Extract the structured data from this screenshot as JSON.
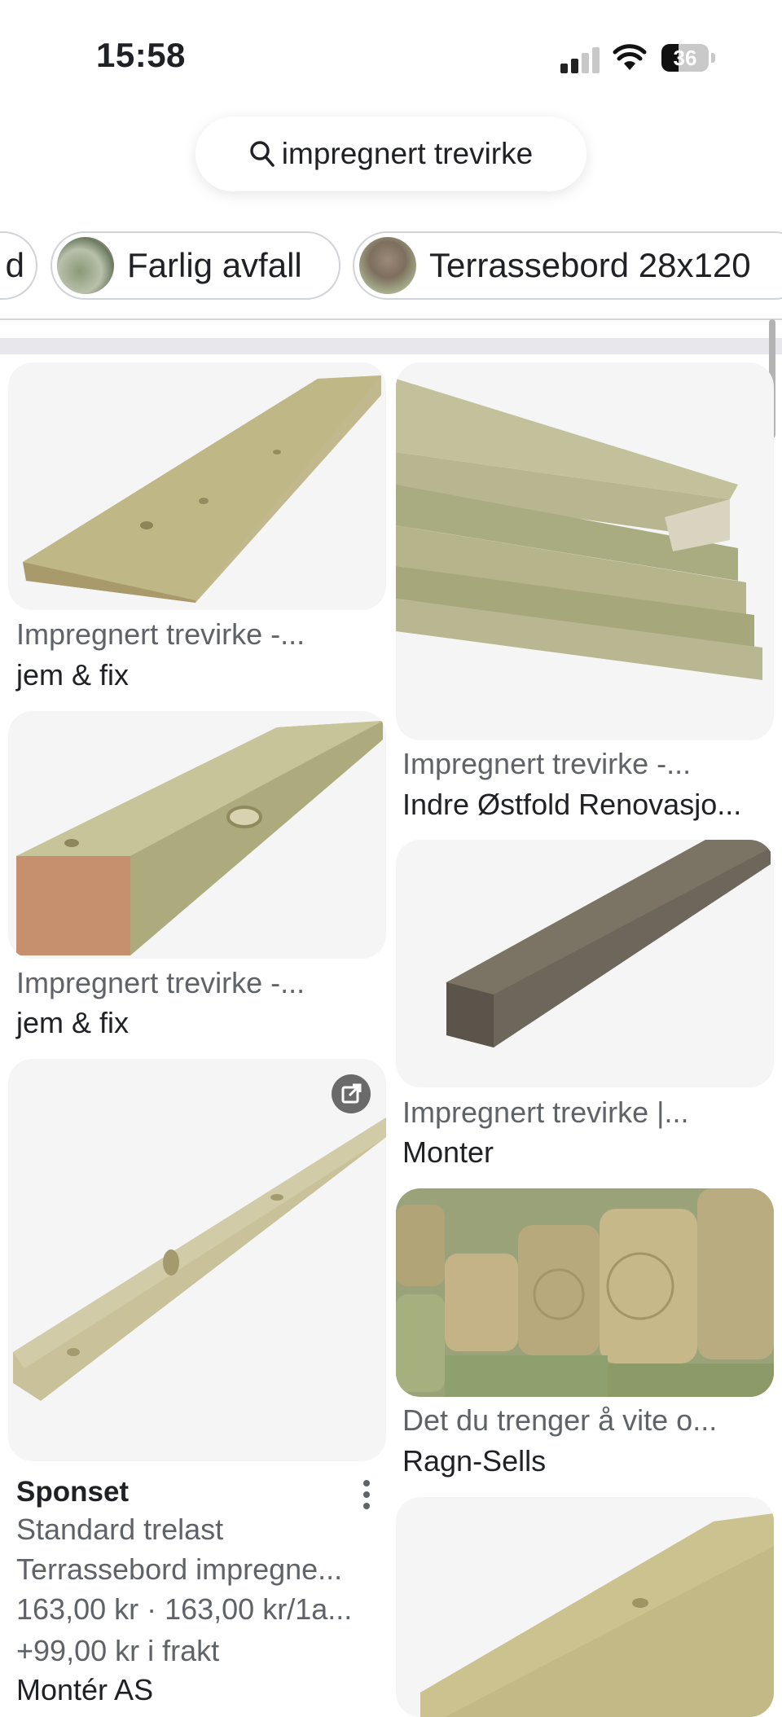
{
  "status_bar": {
    "time": "15:58",
    "battery": "36"
  },
  "search": {
    "query": "impregnert trevirke"
  },
  "chips": [
    {
      "label": "d"
    },
    {
      "label": "Farlig avfall"
    },
    {
      "label": "Terrassebord 28x120"
    }
  ],
  "results": {
    "left": [
      {
        "title": "Impregnert trevirke -...",
        "source": "jem & fix"
      },
      {
        "title": "Impregnert trevirke -...",
        "source": "jem & fix"
      }
    ],
    "right": [
      {
        "title": "Impregnert trevirke -...",
        "source": "Indre Østfold Renovasjo..."
      },
      {
        "title": "Impregnert trevirke |...",
        "source": "Monter"
      },
      {
        "title": "Det du trenger å vite o...",
        "source": "Ragn-Sells"
      }
    ],
    "sponsored": {
      "label": "Sponset",
      "line1": "Standard trelast",
      "line2": "Terrassebord impregne...",
      "price": "163,00 kr · 163,00 kr/1a...",
      "shipping": "+99,00 kr i frakt",
      "seller": "Montér AS"
    }
  },
  "icons": {
    "search": "search-icon",
    "more": "more-vert-icon",
    "external": "open-external-icon"
  }
}
